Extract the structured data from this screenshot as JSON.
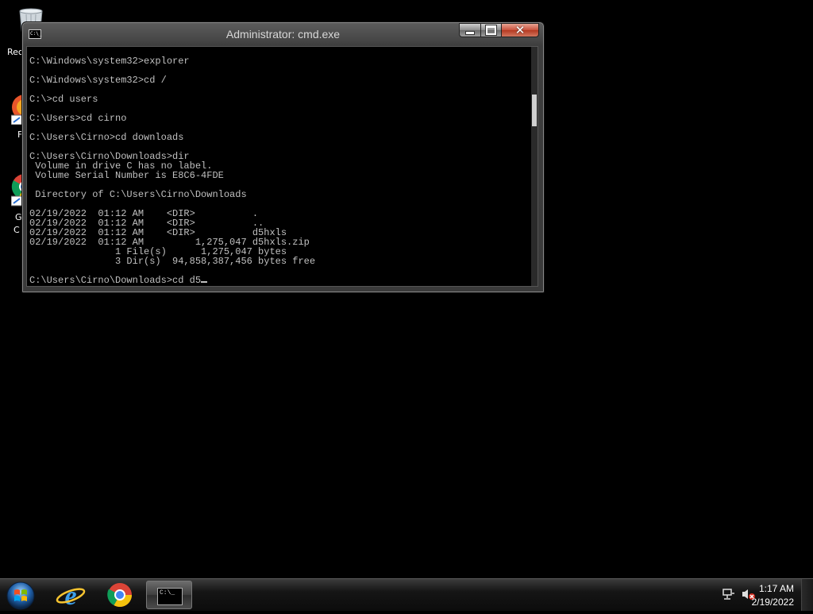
{
  "desktop": {
    "icons": [
      {
        "label": "Rec",
        "icon": "recycle-bin-icon"
      },
      {
        "label": "F",
        "icon": "firefox-icon"
      },
      {
        "label": "G",
        "label2": "C",
        "icon": "google-chrome-icon"
      }
    ]
  },
  "window": {
    "title": "Administrator: cmd.exe",
    "system_icon_text": "C:\\_",
    "buttons": {
      "minimize": "minimize",
      "maximize": "maximize",
      "close": "close"
    },
    "console_lines": [
      "C:\\Windows\\system32>explorer",
      "",
      "C:\\Windows\\system32>cd /",
      "",
      "C:\\>cd users",
      "",
      "C:\\Users>cd cirno",
      "",
      "C:\\Users\\Cirno>cd downloads",
      "",
      "C:\\Users\\Cirno\\Downloads>dir",
      " Volume in drive C has no label.",
      " Volume Serial Number is E8C6-4FDE",
      "",
      " Directory of C:\\Users\\Cirno\\Downloads",
      "",
      "02/19/2022  01:12 AM    <DIR>          .",
      "02/19/2022  01:12 AM    <DIR>          ..",
      "02/19/2022  01:12 AM    <DIR>          d5hxls",
      "02/19/2022  01:12 AM         1,275,047 d5hxls.zip",
      "               1 File(s)      1,275,047 bytes",
      "               3 Dir(s)  94,858,387,456 bytes free",
      ""
    ],
    "prompt": "C:\\Users\\Cirno\\Downloads>cd d5"
  },
  "taskbar": {
    "start_icon": "windows-start-orb-icon",
    "pinned": [
      {
        "name": "internet-explorer",
        "icon": "internet-explorer-icon"
      },
      {
        "name": "google-chrome",
        "icon": "chrome-icon"
      },
      {
        "name": "cmd",
        "icon": "command-prompt-icon",
        "icon_text": "C:\\_"
      }
    ],
    "tray": {
      "network_icon": "network-icon",
      "volume_icon": "volume-muted-icon",
      "time": "1:17 AM",
      "date": "2/19/2022"
    }
  }
}
